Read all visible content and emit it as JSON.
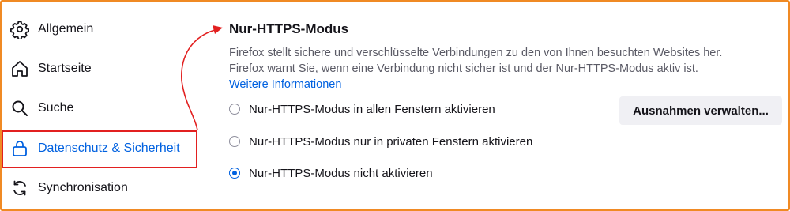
{
  "sidebar": {
    "items": [
      {
        "label": "Allgemein",
        "icon": "gear-icon"
      },
      {
        "label": "Startseite",
        "icon": "home-icon"
      },
      {
        "label": "Suche",
        "icon": "search-icon"
      },
      {
        "label": "Datenschutz & Sicherheit",
        "icon": "lock-icon",
        "selected": true
      },
      {
        "label": "Synchronisation",
        "icon": "sync-icon"
      }
    ]
  },
  "main": {
    "title": "Nur-HTTPS-Modus",
    "description_line1": "Firefox stellt sichere und verschlüsselte Verbindungen zu den von Ihnen besuchten Websites her.",
    "description_line2": "Firefox warnt Sie, wenn eine Verbindung nicht sicher ist und der Nur-HTTPS-Modus aktiv ist.",
    "link_label": "Weitere Informationen",
    "options": [
      {
        "label": "Nur-HTTPS-Modus in allen Fenstern aktivieren",
        "checked": false
      },
      {
        "label": "Nur-HTTPS-Modus nur in privaten Fenstern aktivieren",
        "checked": false
      },
      {
        "label": "Nur-HTTPS-Modus nicht aktivieren",
        "checked": true
      }
    ],
    "exceptions_button": "Ausnahmen verwalten..."
  },
  "colors": {
    "frame_border": "#f08a24",
    "accent": "#0061e0",
    "annotation": "#e22020"
  }
}
